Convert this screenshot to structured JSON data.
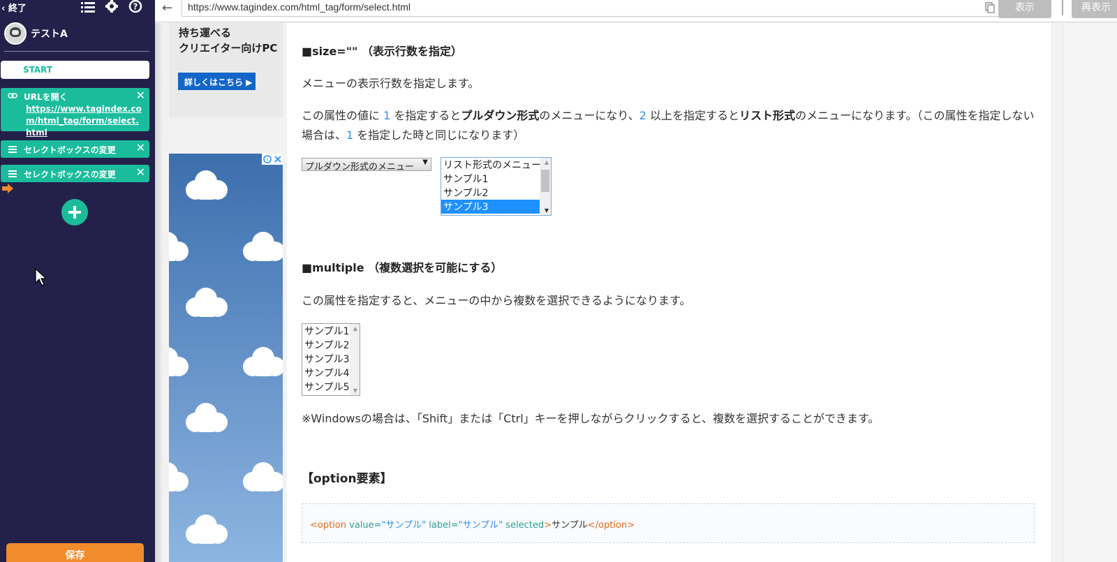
{
  "sidebar": {
    "back_label": "終了",
    "user_name": "テストA",
    "start_label": "START",
    "steps": [
      {
        "title": "URLを開く",
        "url": "https://www.tagindex.com/html_tag/form/select.html"
      },
      {
        "title": "セレクトボックスの変更"
      },
      {
        "title": "セレクトボックスの変更"
      }
    ],
    "save_label": "保存"
  },
  "browser": {
    "url": "https://www.tagindex.com/html_tag/form/select.html",
    "show_label": "表示",
    "reshow_label": "再表示"
  },
  "ads": {
    "ad1_text": "持ち運べる\nクリエイター向けPC",
    "ad1_button": "詳しくはこちら ▶"
  },
  "content": {
    "size_heading": "■size=\"\" （表示行数を指定）",
    "size_desc": "メニューの表示行数を指定します。",
    "size_detail": {
      "t1": "この属性の値に ",
      "n1": "1",
      "t2": " を指定すると",
      "b1": "プルダウン形式",
      "t3": "のメニューになり、",
      "n2": "2",
      "t4": " 以上を指定すると",
      "b2": "リスト形式",
      "t5": "のメニューになります。（この属性を指定しない場合は、",
      "n3": "1",
      "t6": " を指定した時と同じになります）"
    },
    "dropdown_value": "プルダウン形式のメニュー",
    "list_options": [
      "リスト形式のメニュー",
      "サンプル1",
      "サンプル2",
      "サンプル3"
    ],
    "multiple_heading": "■multiple （複数選択を可能にする）",
    "multiple_desc": "この属性を指定すると、メニューの中から複数を選択できるようになります。",
    "multi_options": [
      "サンプル1",
      "サンプル2",
      "サンプル3",
      "サンプル4",
      "サンプル5"
    ],
    "windows_note": "※Windowsの場合は、「Shift」または「Ctrl」キーを押しながらクリックすると、複数を選択することができます。",
    "option_heading": "【option要素】",
    "code": {
      "open_tag": "<option",
      "attr1": " value=",
      "val1": "\"サンプル\"",
      "attr2": " label=",
      "val2": "\"サンプル\"",
      "attr3": " selected",
      "gt": ">",
      "text": "サンプル",
      "close_tag": "</option>"
    }
  },
  "colors": {
    "sidebar_bg": "#23214a",
    "step_teal": "#1abc9c",
    "save_orange": "#f08c2c",
    "selected_blue": "#1e90ff"
  }
}
